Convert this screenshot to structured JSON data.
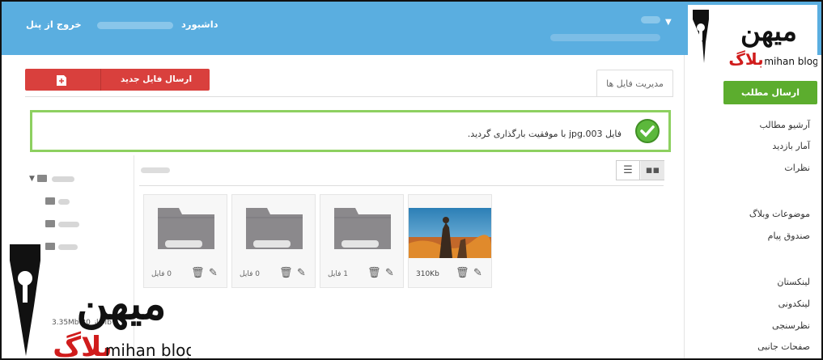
{
  "topbar": {
    "logout": "خروج از پنل",
    "dashboard": "داشبورد"
  },
  "brand": {
    "logo_text_fa": "میهن",
    "logo_sub_fa": "بلاگ",
    "logo_sub_en": "mihan blog"
  },
  "toolbar": {
    "upload_label": "ارسال فایل جدید"
  },
  "tabs": [
    {
      "label": "مدیریت فایل ها"
    }
  ],
  "alert": {
    "message": "فایل 003.jpg با موفقیت بارگذاری گردید."
  },
  "sidebar": {
    "send_post": "ارسال مطلب",
    "items": [
      {
        "label": "آرشیو مطالب"
      },
      {
        "label": "آمار بازدید"
      },
      {
        "label": "نظرات"
      },
      {
        "label": "موضوعات وبلاگ"
      },
      {
        "label": "صندوق پیام"
      },
      {
        "label": "لینکستان"
      },
      {
        "label": "لینکدونی"
      },
      {
        "label": "نظرسنجی"
      },
      {
        "label": "صفحات جانبی"
      }
    ]
  },
  "files": [
    {
      "type": "image",
      "size": "310Kb"
    },
    {
      "type": "folder",
      "size": "1 فایل"
    },
    {
      "type": "folder",
      "size": "0 فایل"
    },
    {
      "type": "folder",
      "size": "0 فایل"
    }
  ],
  "quota": {
    "text": "3.35Mb از 30 Mb"
  },
  "icons": {
    "check": "check-circle-icon",
    "list": "list-view-icon",
    "grid": "grid-view-icon",
    "trash": "trash-icon",
    "edit": "pencil-icon",
    "folder": "folder-icon",
    "upload": "file-add-icon"
  },
  "colors": {
    "topbar": "#5aaee0",
    "upload_button": "#d9403d",
    "send_button": "#5cad2e",
    "alert_border": "#8dd060",
    "check": "#5cb83c"
  }
}
